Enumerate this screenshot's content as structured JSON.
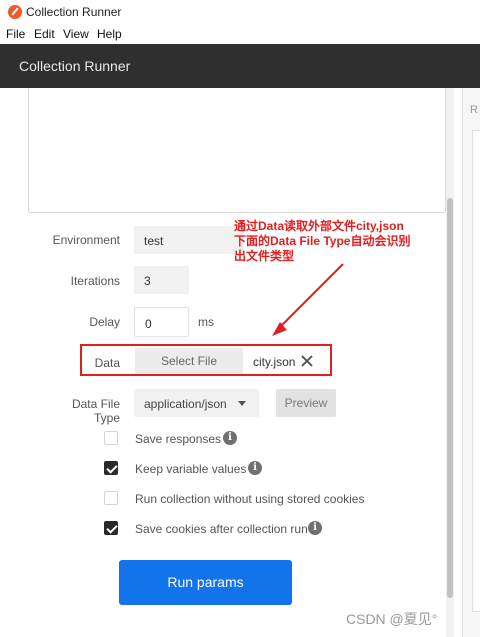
{
  "window": {
    "title": "Collection Runner"
  },
  "menu": {
    "file": "File",
    "edit": "Edit",
    "view": "View",
    "help": "Help"
  },
  "header": {
    "title": "Collection Runner"
  },
  "right_panel": {
    "letter": "R"
  },
  "form": {
    "environment": {
      "label": "Environment",
      "value": "test"
    },
    "iterations": {
      "label": "Iterations",
      "value": "3"
    },
    "delay": {
      "label": "Delay",
      "value": "0",
      "unit": "ms"
    },
    "data": {
      "label": "Data",
      "button": "Select File",
      "filename": "city.json"
    },
    "data_file_type": {
      "label": "Data File Type",
      "selected": "application/json",
      "preview_button": "Preview"
    }
  },
  "options": [
    {
      "label": "Save responses",
      "checked": false,
      "info_icon": true
    },
    {
      "label": "Keep variable values",
      "checked": true,
      "info_icon": true
    },
    {
      "label": "Run collection without using stored cookies",
      "checked": false,
      "info_icon": false
    },
    {
      "label": "Save cookies after collection run",
      "checked": true,
      "info_icon": true
    }
  ],
  "run_button": "Run params",
  "annotation": {
    "line1": "通过Data读取外部文件city,json",
    "line2": "下面的Data File Type自动会识别",
    "line3": "出文件类型",
    "color": "#e02020"
  },
  "watermark": "CSDN @夏见°",
  "colors": {
    "header_bg": "#2f2f2f",
    "primary": "#1273ea",
    "highlight": "#e02020"
  }
}
